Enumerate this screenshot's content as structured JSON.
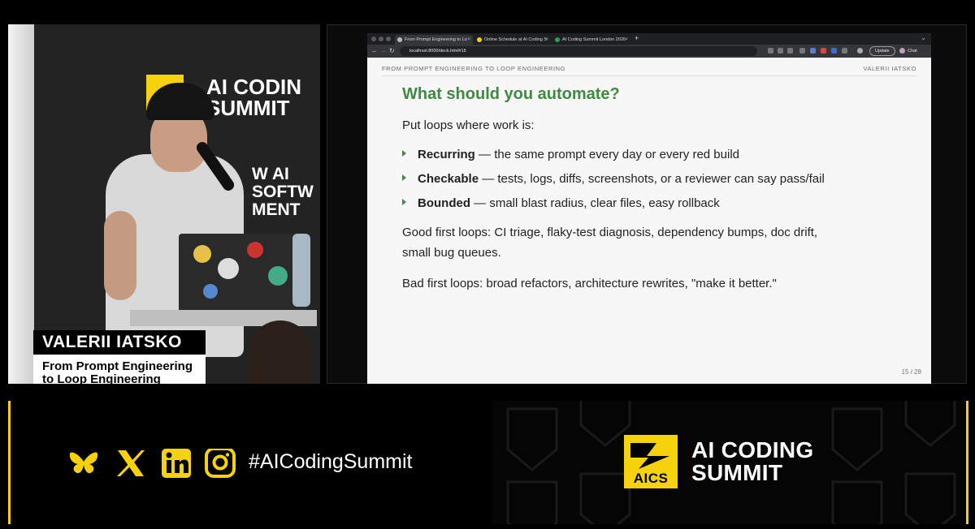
{
  "colors": {
    "accent_yellow": "#f5d20a",
    "slide_title_green": "#3f8a42",
    "background": "#000000"
  },
  "speaker": {
    "name": "VALERII IATSKO",
    "talk_line1": "From Prompt Engineering",
    "talk_line2": "to Loop Engineering",
    "backdrop_logo_line1": "AI CODIN",
    "backdrop_logo_line2": "SUMMIT",
    "backdrop_sub1": "W AI",
    "backdrop_sub2": "SOFTW",
    "backdrop_sub3": "MENT"
  },
  "browser": {
    "tabs": [
      {
        "label": "From Prompt Engineering to Lo",
        "favicon": "globe-icon"
      },
      {
        "label": "Online Schedule at AI Coding S",
        "favicon": "bolt-icon"
      },
      {
        "label": "AI Coding Summit London 2026",
        "favicon": "green-dot-icon"
      }
    ],
    "new_tab": "+",
    "url": "localhost:8000/deck.html#15",
    "update_label": "Update",
    "chat_label": "Chat"
  },
  "slide": {
    "header_left": "FROM PROMPT ENGINEERING TO LOOP ENGINEERING",
    "header_right": "VALERII IATSKO",
    "title": "What should you automate?",
    "intro": "Put loops where work is:",
    "bullets": [
      {
        "term": "Recurring",
        "desc": " — the same prompt every day or every red build"
      },
      {
        "term": "Checkable",
        "desc": " — tests, logs, diffs, screenshots, or a reviewer can say pass/fail"
      },
      {
        "term": "Bounded",
        "desc": " — small blast radius, clear files, easy rollback"
      }
    ],
    "good_line1": "Good first loops: CI triage, flaky-test diagnosis, dependency bumps, doc drift,",
    "good_line2": "small bug queues.",
    "bad": "Bad first loops: broad refactors, architecture rewrites, \"make it better.\"",
    "page": "15 / 28"
  },
  "social": {
    "icons": [
      "bluesky-icon",
      "x-icon",
      "linkedin-icon",
      "instagram-icon"
    ],
    "hashtag": "#AICodingSummit"
  },
  "brand": {
    "mark": "AICS",
    "name_line1": "AI CODING",
    "name_line2": "SUMMIT"
  }
}
